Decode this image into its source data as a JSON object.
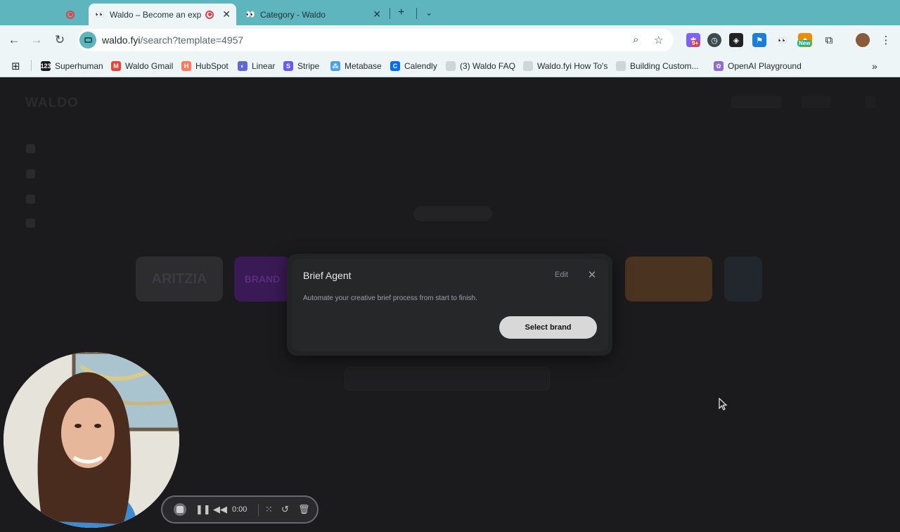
{
  "browser": {
    "tabs": [
      {
        "title": "Waldo – Become an expert",
        "recording": true
      },
      {
        "title": "Category - Waldo"
      }
    ],
    "url_host": "waldo.fyi",
    "url_path": "/search?template=4957",
    "extension_badges": {
      "notifications": "9+",
      "new": "New"
    }
  },
  "bookmarks": [
    {
      "label": "Superhuman",
      "icon": "superhuman-icon",
      "color": "#1a1a1a",
      "glyph": "123"
    },
    {
      "label": "Waldo Gmail",
      "icon": "gmail-icon",
      "color": "#ea4335",
      "glyph": "M"
    },
    {
      "label": "HubSpot",
      "icon": "hubspot-icon",
      "color": "#ff7a59",
      "glyph": "H"
    },
    {
      "label": "Linear",
      "icon": "linear-icon",
      "color": "#5e6ad2",
      "glyph": "◐"
    },
    {
      "label": "Stripe",
      "icon": "stripe-icon",
      "color": "#635bff",
      "glyph": "S"
    },
    {
      "label": "Metabase",
      "icon": "metabase-icon",
      "color": "#509ee3",
      "glyph": "⁂"
    },
    {
      "label": "Calendly",
      "icon": "calendly-icon",
      "color": "#006bff",
      "glyph": "C"
    },
    {
      "label": "(3) Waldo FAQ",
      "icon": "faq-icon",
      "color": "#cfd6d8",
      "glyph": ""
    },
    {
      "label": "Waldo.fyi How To's",
      "icon": "howto-icon",
      "color": "#cfd6d8",
      "glyph": ""
    },
    {
      "label": "Building Custom...",
      "icon": "doc-icon",
      "color": "#cfd6d8",
      "glyph": ""
    },
    {
      "label": "OpenAI Playground",
      "icon": "openai-icon",
      "color": "#8e6bd8",
      "glyph": "✿"
    }
  ],
  "page": {
    "logo": "WALDO",
    "brand_cards": [
      "ARITZIA",
      "BRAND",
      "",
      "",
      ""
    ]
  },
  "modal": {
    "title": "Brief Agent",
    "edit_label": "Edit",
    "description": "Automate your creative brief process from start to finish.",
    "primary_button": "Select brand"
  },
  "recorder": {
    "time": "0:00"
  }
}
